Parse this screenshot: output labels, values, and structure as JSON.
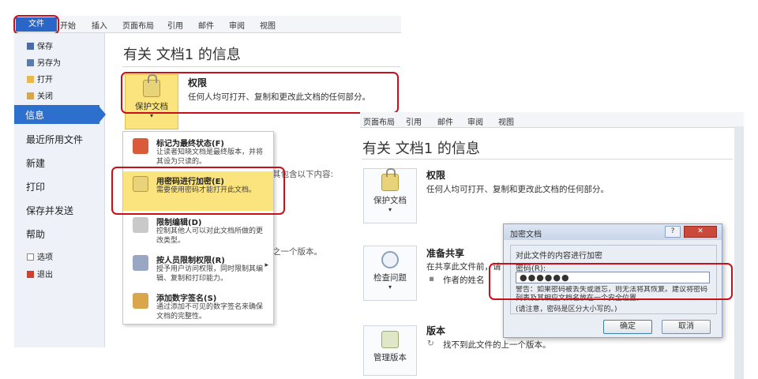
{
  "ribbon": {
    "file_tab": "文件",
    "tabs": [
      "开始",
      "插入",
      "页面布局",
      "引用",
      "邮件",
      "审阅",
      "视图"
    ]
  },
  "backstage": {
    "small_items": [
      {
        "label": "保存",
        "icon": "save-icon"
      },
      {
        "label": "另存为",
        "icon": "save-as-icon"
      },
      {
        "label": "打开",
        "icon": "open-folder-icon"
      },
      {
        "label": "关闭",
        "icon": "close-doc-icon"
      }
    ],
    "selected": "信息",
    "large_items": [
      "最近所用文件",
      "新建",
      "打印",
      "保存并发送",
      "帮助"
    ],
    "bottom_items": [
      {
        "label": "选项",
        "icon": "options-icon"
      },
      {
        "label": "退出",
        "icon": "exit-icon"
      }
    ]
  },
  "info": {
    "title": "有关 文档1 的信息",
    "protect_button": "保护文档",
    "permissions_title": "权限",
    "permissions_desc": "任何人均可打开、复制和更改此文档的任何部分。",
    "partial_hidden_1": "其包含以下内容:",
    "partial_hidden_2": "之一个版本。"
  },
  "protect_menu": [
    {
      "title": "标记为最终状态(F)",
      "desc": "让读者知晓文档是最终版本，并将其设为只读的。",
      "icon": "mark-final-icon"
    },
    {
      "title": "用密码进行加密(E)",
      "desc": "需要使用密码才能打开此文档。",
      "icon": "encrypt-lock-icon"
    },
    {
      "title": "限制编辑(D)",
      "desc": "控制其他人可以对此文档所做的更改类型。",
      "icon": "restrict-edit-icon"
    },
    {
      "title": "按人员限制权限(R)",
      "desc": "授予用户访问权限，同时限制其编辑、复制和打印能力。",
      "icon": "people-permission-icon"
    },
    {
      "title": "添加数字签名(S)",
      "desc": "通过添加不可见的数字签名来确保文档的完整性。",
      "icon": "digital-signature-icon"
    }
  ],
  "screen2": {
    "tabs": [
      "页面布局",
      "引用",
      "邮件",
      "审阅",
      "视图"
    ],
    "title": "有关 文档1 的信息",
    "protect_button": "保护文档",
    "permissions_title": "权限",
    "permissions_desc": "任何人均可打开、复制和更改此文档的任何部分。",
    "inspect_button": "检查问题",
    "prepare_title": "准备共享",
    "prepare_desc": "在共享此文件前，请",
    "author_label": "作者的姓名",
    "version_button": "管理版本",
    "version_title": "版本",
    "version_desc": "找不到此文件的上一个版本。"
  },
  "dialog": {
    "title": "加密文档",
    "help": "?",
    "close": "✕",
    "group_label": "对此文件的内容进行加密",
    "password_label": "密码(R):",
    "password_value": "●●●●●●",
    "warning": "警告：如果密码被丢失或遗忘，则无法将其恢复。建议将密码列表及其相应文档名放在一个安全位置。",
    "note": "(请注意，密码是区分大小写的。)",
    "ok": "确定",
    "cancel": "取消"
  },
  "colors": {
    "accent": "#2d6fcc",
    "highlight_red": "#c8101a",
    "menu_highlight": "#fbe37d"
  }
}
